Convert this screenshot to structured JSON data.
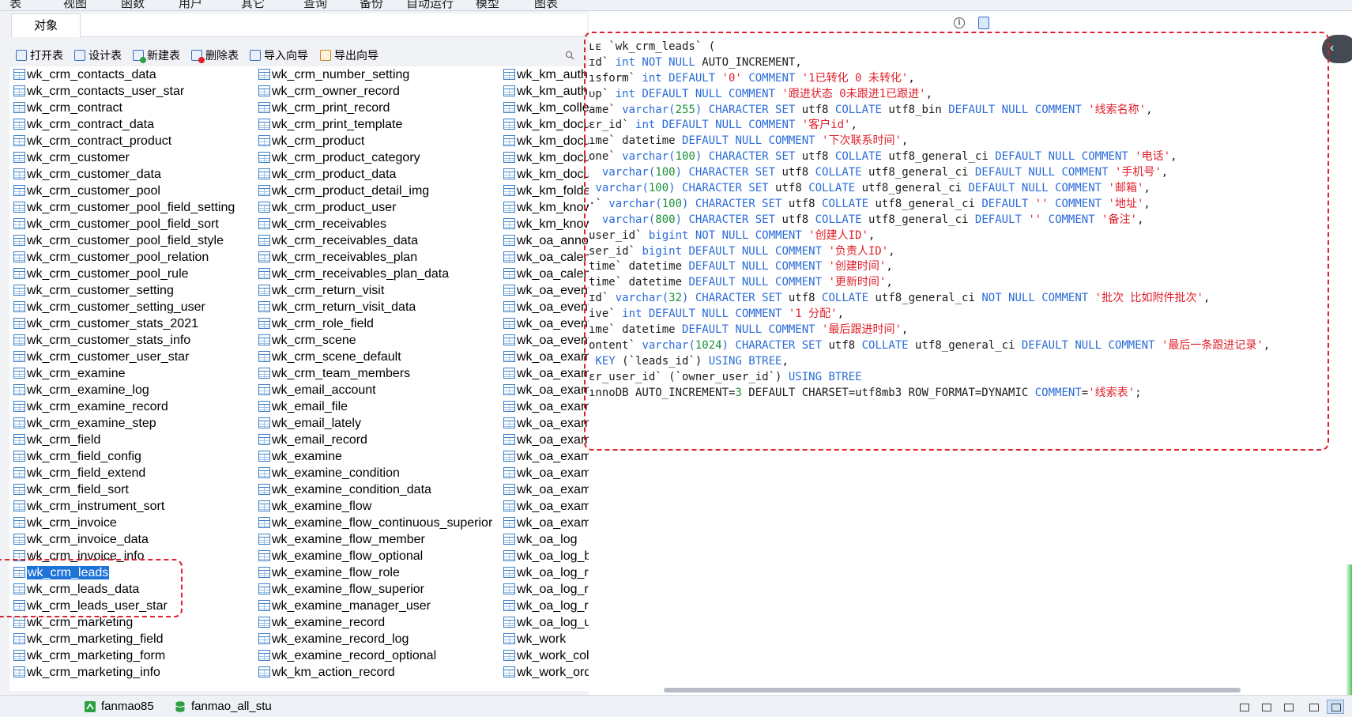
{
  "menu": [
    "表",
    "视图",
    "函数",
    "用户",
    "其它",
    "查询",
    "备份",
    "自动运行",
    "模型",
    "图表"
  ],
  "tab": {
    "label": "对象"
  },
  "toolbar": [
    "打开表",
    "设计表",
    "新建表",
    "删除表",
    "导入向导",
    "导出向导"
  ],
  "colors": {
    "accent": "#1e73d8",
    "keyword": "#2a6bd9",
    "string": "#e0202a",
    "number": "#1a8f3a",
    "highlight": "#e0202a"
  },
  "tables": {
    "col1": [
      "wk_crm_contacts_data",
      "wk_crm_contacts_user_star",
      "wk_crm_contract",
      "wk_crm_contract_data",
      "wk_crm_contract_product",
      "wk_crm_customer",
      "wk_crm_customer_data",
      "wk_crm_customer_pool",
      "wk_crm_customer_pool_field_setting",
      "wk_crm_customer_pool_field_sort",
      "wk_crm_customer_pool_field_style",
      "wk_crm_customer_pool_relation",
      "wk_crm_customer_pool_rule",
      "wk_crm_customer_setting",
      "wk_crm_customer_setting_user",
      "wk_crm_customer_stats_2021",
      "wk_crm_customer_stats_info",
      "wk_crm_customer_user_star",
      "wk_crm_examine",
      "wk_crm_examine_log",
      "wk_crm_examine_record",
      "wk_crm_examine_step",
      "wk_crm_field",
      "wk_crm_field_config",
      "wk_crm_field_extend",
      "wk_crm_field_sort",
      "wk_crm_instrument_sort",
      "wk_crm_invoice",
      "wk_crm_invoice_data",
      "wk_crm_invoice_info",
      "wk_crm_leads",
      "wk_crm_leads_data",
      "wk_crm_leads_user_star",
      "wk_crm_marketing",
      "wk_crm_marketing_field",
      "wk_crm_marketing_form",
      "wk_crm_marketing_info"
    ],
    "col2": [
      "wk_crm_number_setting",
      "wk_crm_owner_record",
      "wk_crm_print_record",
      "wk_crm_print_template",
      "wk_crm_product",
      "wk_crm_product_category",
      "wk_crm_product_data",
      "wk_crm_product_detail_img",
      "wk_crm_product_user",
      "wk_crm_receivables",
      "wk_crm_receivables_data",
      "wk_crm_receivables_plan",
      "wk_crm_receivables_plan_data",
      "wk_crm_return_visit",
      "wk_crm_return_visit_data",
      "wk_crm_role_field",
      "wk_crm_scene",
      "wk_crm_scene_default",
      "wk_crm_team_members",
      "wk_email_account",
      "wk_email_file",
      "wk_email_lately",
      "wk_email_record",
      "wk_examine",
      "wk_examine_condition",
      "wk_examine_condition_data",
      "wk_examine_flow",
      "wk_examine_flow_continuous_superior",
      "wk_examine_flow_member",
      "wk_examine_flow_optional",
      "wk_examine_flow_role",
      "wk_examine_flow_superior",
      "wk_examine_manager_user",
      "wk_examine_record",
      "wk_examine_record_log",
      "wk_examine_record_optional",
      "wk_km_action_record"
    ],
    "col3": [
      "wk_km_auth",
      "wk_km_auth",
      "wk_km_colle",
      "wk_km_docu",
      "wk_km_docu",
      "wk_km_docu",
      "wk_km_docu",
      "wk_km_folde",
      "wk_km_know",
      "wk_km_know",
      "wk_oa_annou",
      "wk_oa_calen",
      "wk_oa_calen",
      "wk_oa_event",
      "wk_oa_event",
      "wk_oa_event",
      "wk_oa_event",
      "wk_oa_exam",
      "wk_oa_exam",
      "wk_oa_exam",
      "wk_oa_exam",
      "wk_oa_exam",
      "wk_oa_exam",
      "wk_oa_exam",
      "wk_oa_exam",
      "wk_oa_exam",
      "wk_oa_exam",
      "wk_oa_exam",
      "wk_oa_log",
      "wk_oa_log_b",
      "wk_oa_log_r",
      "wk_oa_log_r",
      "wk_oa_log_r",
      "wk_oa_log_u",
      "wk_work",
      "wk_work_col",
      "wk_work_ord"
    ],
    "selected": "wk_crm_leads"
  },
  "ddl": [
    [
      [
        "t",
        "ʟᴇ `wk_crm_leads` ("
      ]
    ],
    [
      [
        "t",
        "ɪd` "
      ],
      [
        "k",
        "int NOT NULL"
      ],
      [
        "t",
        " AUTO_INCREMENT,"
      ]
    ],
    [
      [
        "t",
        "ısform` "
      ],
      [
        "k",
        "int DEFAULT "
      ],
      [
        "s",
        "'0'"
      ],
      [
        "k",
        " COMMENT "
      ],
      [
        "s",
        "'1已转化 0 未转化'"
      ],
      [
        "t",
        ","
      ]
    ],
    [
      [
        "t",
        "ᴜp` "
      ],
      [
        "k",
        "int DEFAULT NULL COMMENT "
      ],
      [
        "s",
        "'跟进状态 0未跟进1已跟进'"
      ],
      [
        "t",
        ","
      ]
    ],
    [
      [
        "t",
        "ame` "
      ],
      [
        "k",
        "varchar("
      ],
      [
        "n",
        "255"
      ],
      [
        "k",
        ") CHARACTER SET"
      ],
      [
        "t",
        " utf8 "
      ],
      [
        "k",
        "COLLATE"
      ],
      [
        "t",
        " utf8_bin "
      ],
      [
        "k",
        "DEFAULT NULL COMMENT "
      ],
      [
        "s",
        "'线索名称'"
      ],
      [
        "t",
        ","
      ]
    ],
    [
      [
        "t",
        "ɛr_id` "
      ],
      [
        "k",
        "int DEFAULT NULL COMMENT "
      ],
      [
        "s",
        "'客户id'"
      ],
      [
        "t",
        ","
      ]
    ],
    [
      [
        "t",
        "ıme` datetime "
      ],
      [
        "k",
        "DEFAULT NULL COMMENT "
      ],
      [
        "s",
        "'下次联系时间'"
      ],
      [
        "t",
        ","
      ]
    ],
    [
      [
        "t",
        "one` "
      ],
      [
        "k",
        "varchar("
      ],
      [
        "n",
        "100"
      ],
      [
        "k",
        ") CHARACTER SET"
      ],
      [
        "t",
        " utf8 "
      ],
      [
        "k",
        "COLLATE"
      ],
      [
        "t",
        " utf8_general_ci "
      ],
      [
        "k",
        "DEFAULT NULL COMMENT "
      ],
      [
        "s",
        "'电话'"
      ],
      [
        "t",
        ","
      ]
    ],
    [
      [
        "t",
        "  "
      ],
      [
        "k",
        "varchar("
      ],
      [
        "n",
        "100"
      ],
      [
        "k",
        ") CHARACTER SET"
      ],
      [
        "t",
        " utf8 "
      ],
      [
        "k",
        "COLLATE"
      ],
      [
        "t",
        " utf8_general_ci "
      ],
      [
        "k",
        "DEFAULT NULL COMMENT "
      ],
      [
        "s",
        "'手机号'"
      ],
      [
        "t",
        ","
      ]
    ],
    [
      [
        "t",
        " "
      ],
      [
        "k",
        "varchar("
      ],
      [
        "n",
        "100"
      ],
      [
        "k",
        ") CHARACTER SET"
      ],
      [
        "t",
        " utf8 "
      ],
      [
        "k",
        "COLLATE"
      ],
      [
        "t",
        " utf8_general_ci "
      ],
      [
        "k",
        "DEFAULT NULL COMMENT "
      ],
      [
        "s",
        "'邮箱'"
      ],
      [
        "t",
        ","
      ]
    ],
    [
      [
        "t",
        "·` "
      ],
      [
        "k",
        "varchar("
      ],
      [
        "n",
        "100"
      ],
      [
        "k",
        ") CHARACTER SET"
      ],
      [
        "t",
        " utf8 "
      ],
      [
        "k",
        "COLLATE"
      ],
      [
        "t",
        " utf8_general_ci "
      ],
      [
        "k",
        "DEFAULT "
      ],
      [
        "s",
        "''"
      ],
      [
        "k",
        " COMMENT "
      ],
      [
        "s",
        "'地址'"
      ],
      [
        "t",
        ","
      ]
    ],
    [
      [
        "t",
        "  "
      ],
      [
        "k",
        "varchar("
      ],
      [
        "n",
        "800"
      ],
      [
        "k",
        ") CHARACTER SET"
      ],
      [
        "t",
        " utf8 "
      ],
      [
        "k",
        "COLLATE"
      ],
      [
        "t",
        " utf8_general_ci "
      ],
      [
        "k",
        "DEFAULT "
      ],
      [
        "s",
        "''"
      ],
      [
        "k",
        " COMMENT "
      ],
      [
        "s",
        "'备注'"
      ],
      [
        "t",
        ","
      ]
    ],
    [
      [
        "t",
        "user_id` "
      ],
      [
        "k",
        "bigint NOT NULL COMMENT "
      ],
      [
        "s",
        "'创建人ID'"
      ],
      [
        "t",
        ","
      ]
    ],
    [
      [
        "t",
        "ser_id` "
      ],
      [
        "k",
        "bigint DEFAULT NULL COMMENT "
      ],
      [
        "s",
        "'负责人ID'"
      ],
      [
        "t",
        ","
      ]
    ],
    [
      [
        "t",
        "time` datetime "
      ],
      [
        "k",
        "DEFAULT NULL COMMENT "
      ],
      [
        "s",
        "'创建时间'"
      ],
      [
        "t",
        ","
      ]
    ],
    [
      [
        "t",
        "time` datetime "
      ],
      [
        "k",
        "DEFAULT NULL COMMENT "
      ],
      [
        "s",
        "'更新时间'"
      ],
      [
        "t",
        ","
      ]
    ],
    [
      [
        "t",
        "ɪd` "
      ],
      [
        "k",
        "varchar("
      ],
      [
        "n",
        "32"
      ],
      [
        "k",
        ") CHARACTER SET"
      ],
      [
        "t",
        " utf8 "
      ],
      [
        "k",
        "COLLATE"
      ],
      [
        "t",
        " utf8_general_ci "
      ],
      [
        "k",
        "NOT NULL COMMENT "
      ],
      [
        "s",
        "'批次 比如附件批次'"
      ],
      [
        "t",
        ","
      ]
    ],
    [
      [
        "t",
        "ive` "
      ],
      [
        "k",
        "int DEFAULT NULL COMMENT "
      ],
      [
        "s",
        "'1 分配'"
      ],
      [
        "t",
        ","
      ]
    ],
    [
      [
        "t",
        "ıme` datetime "
      ],
      [
        "k",
        "DEFAULT NULL COMMENT "
      ],
      [
        "s",
        "'最后跟进时间'"
      ],
      [
        "t",
        ","
      ]
    ],
    [
      [
        "t",
        "ontent` "
      ],
      [
        "k",
        "varchar("
      ],
      [
        "n",
        "1024"
      ],
      [
        "k",
        ") CHARACTER SET"
      ],
      [
        "t",
        " utf8 "
      ],
      [
        "k",
        "COLLATE"
      ],
      [
        "t",
        " utf8_general_ci "
      ],
      [
        "k",
        "DEFAULT NULL COMMENT "
      ],
      [
        "s",
        "'最后一条跟进记录'"
      ],
      [
        "t",
        ","
      ]
    ],
    [
      [
        "k",
        " KEY"
      ],
      [
        "t",
        " (`leads_id`) "
      ],
      [
        "k",
        "USING BTREE"
      ],
      [
        "t",
        ","
      ]
    ],
    [
      [
        "t",
        "ɛr_user_id` (`owner_user_id`) "
      ],
      [
        "k",
        "USING BTREE"
      ]
    ],
    [
      [
        "t",
        "ınnoDB AUTO_INCREMENT="
      ],
      [
        "n",
        "3"
      ],
      [
        "t",
        " DEFAULT CHARSET=utf8mb3 ROW_FORMAT=DYNAMIC "
      ],
      [
        "k",
        "COMMENT"
      ],
      [
        "t",
        "="
      ],
      [
        "s",
        "'线索表'"
      ],
      [
        "t",
        ";"
      ]
    ]
  ],
  "status": {
    "connection": "fanmao85",
    "database": "fanmao_all_stu"
  },
  "icons": {
    "info": "info-icon",
    "ddl": "ddl-view-icon",
    "collapse": "chevron-left-icon",
    "search": "search-icon"
  }
}
